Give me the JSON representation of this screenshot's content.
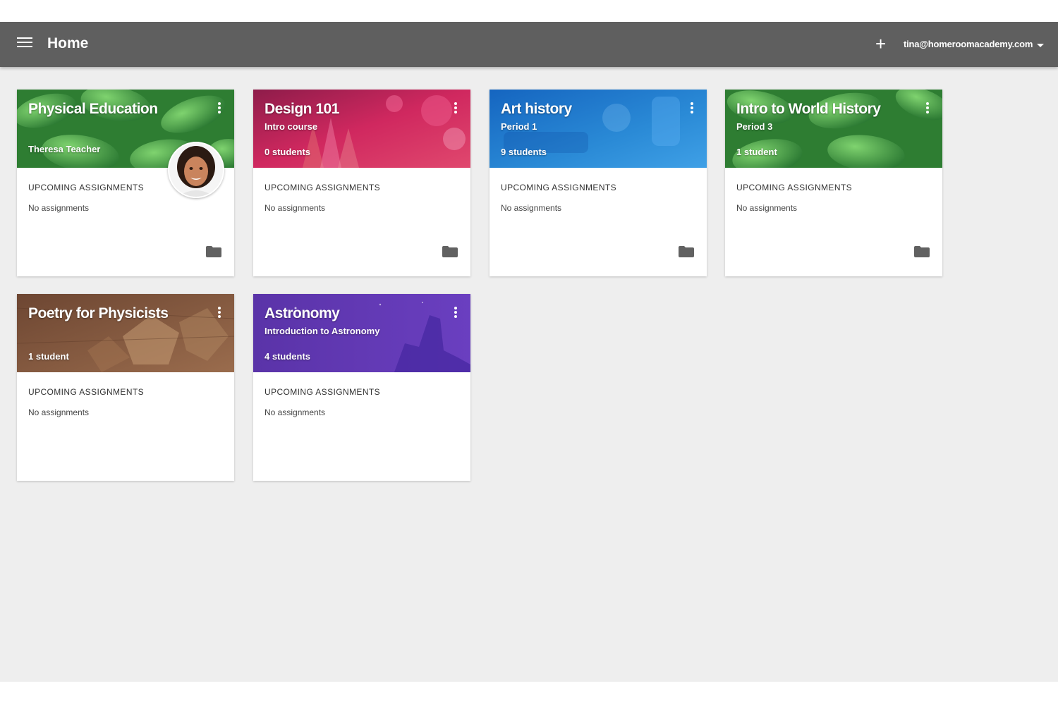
{
  "topbar": {
    "title": "Home",
    "account": "tina@homeroomacademy.com"
  },
  "colors": {
    "topbar": "#5f5f5f",
    "background": "#eeeeee",
    "physical_education": "#3e9a47",
    "design": "#c2185b",
    "art_history": "#1e7fd3",
    "world_history": "#3e9a47",
    "poetry": "#7a5239",
    "astronomy": "#5e35b1"
  },
  "cards": [
    {
      "title": "Physical Education",
      "subtitle": "",
      "count": "Theresa Teacher",
      "upcoming": "UPCOMING ASSIGNMENTS",
      "assignments": "No assignments"
    },
    {
      "title": "Design 101",
      "subtitle": "Intro course",
      "count": "0 students",
      "upcoming": "UPCOMING ASSIGNMENTS",
      "assignments": "No assignments"
    },
    {
      "title": "Art history",
      "subtitle": "Period 1",
      "count": "9 students",
      "upcoming": "UPCOMING ASSIGNMENTS",
      "assignments": "No assignments"
    },
    {
      "title": "Intro to World History",
      "subtitle": "Period 3",
      "count": "1 student",
      "upcoming": "UPCOMING ASSIGNMENTS",
      "assignments": "No assignments"
    },
    {
      "title": "Poetry for Physicists",
      "subtitle": "",
      "count": "1 student",
      "upcoming": "UPCOMING ASSIGNMENTS",
      "assignments": "No assignments"
    },
    {
      "title": "Astronomy",
      "subtitle": "Introduction to Astronomy",
      "count": "4 students",
      "upcoming": "UPCOMING ASSIGNMENTS",
      "assignments": "No assignments"
    }
  ]
}
